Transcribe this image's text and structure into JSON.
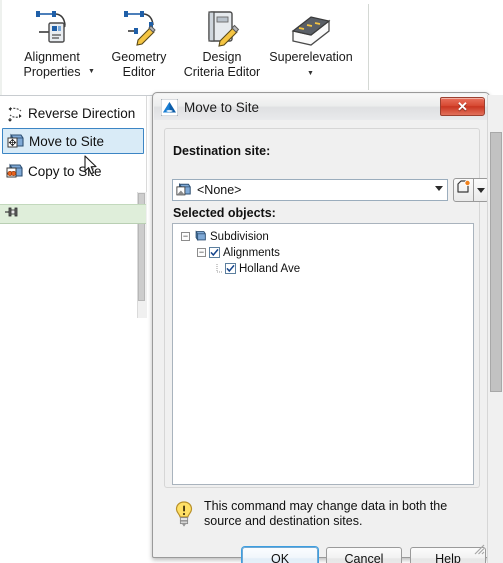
{
  "ribbon": {
    "items": [
      {
        "label": "Alignment\nProperties",
        "icon": "alignment-properties-icon",
        "has_dropdown": true
      },
      {
        "label": "Geometry\nEditor",
        "icon": "geometry-editor-icon",
        "has_dropdown": false
      },
      {
        "label": "Design\nCriteria Editor",
        "icon": "design-criteria-editor-icon",
        "has_dropdown": false
      },
      {
        "label": "Superelevation",
        "icon": "superelevation-icon",
        "has_dropdown": true
      }
    ]
  },
  "menu": {
    "items": [
      {
        "label": "Reverse Direction",
        "icon": "reverse-direction-icon",
        "selected": false
      },
      {
        "label": "Move to Site",
        "icon": "move-to-site-icon",
        "selected": true
      },
      {
        "label": "Copy to Site",
        "icon": "copy-to-site-icon",
        "selected": false
      }
    ],
    "pin_row_icon": "pin-icon"
  },
  "dialog": {
    "title": "Move to Site",
    "app_icon": "autodesk-icon",
    "close_label": "✕",
    "destination": {
      "label": "Destination site:",
      "value": "<None>",
      "icon": "site-icon",
      "new_site_icon": "new-site-icon",
      "dropdown_icon": "chevron-down-icon"
    },
    "selected_objects": {
      "label": "Selected objects:",
      "tree": [
        {
          "label": "Subdivision",
          "depth": 0,
          "expander": "minus",
          "checkbox": null,
          "icon": "site-icon"
        },
        {
          "label": "Alignments",
          "depth": 1,
          "expander": "minus",
          "checkbox": "checked",
          "icon": null
        },
        {
          "label": "Holland Ave",
          "depth": 2,
          "expander": "leaf",
          "checkbox": "checked",
          "icon": null
        }
      ]
    },
    "warning": {
      "icon": "lightbulb-warning-icon",
      "text": "This command may change data in both the source and destination sites."
    },
    "buttons": {
      "ok": "OK",
      "cancel": "Cancel",
      "help": "Help"
    }
  },
  "colors": {
    "accent_blue": "#3c85c4",
    "selection_bg": "#d9ebf7",
    "close_red": "#c93520",
    "green_row": "#dfeeda",
    "dialog_bg": "#f0f0f0"
  }
}
